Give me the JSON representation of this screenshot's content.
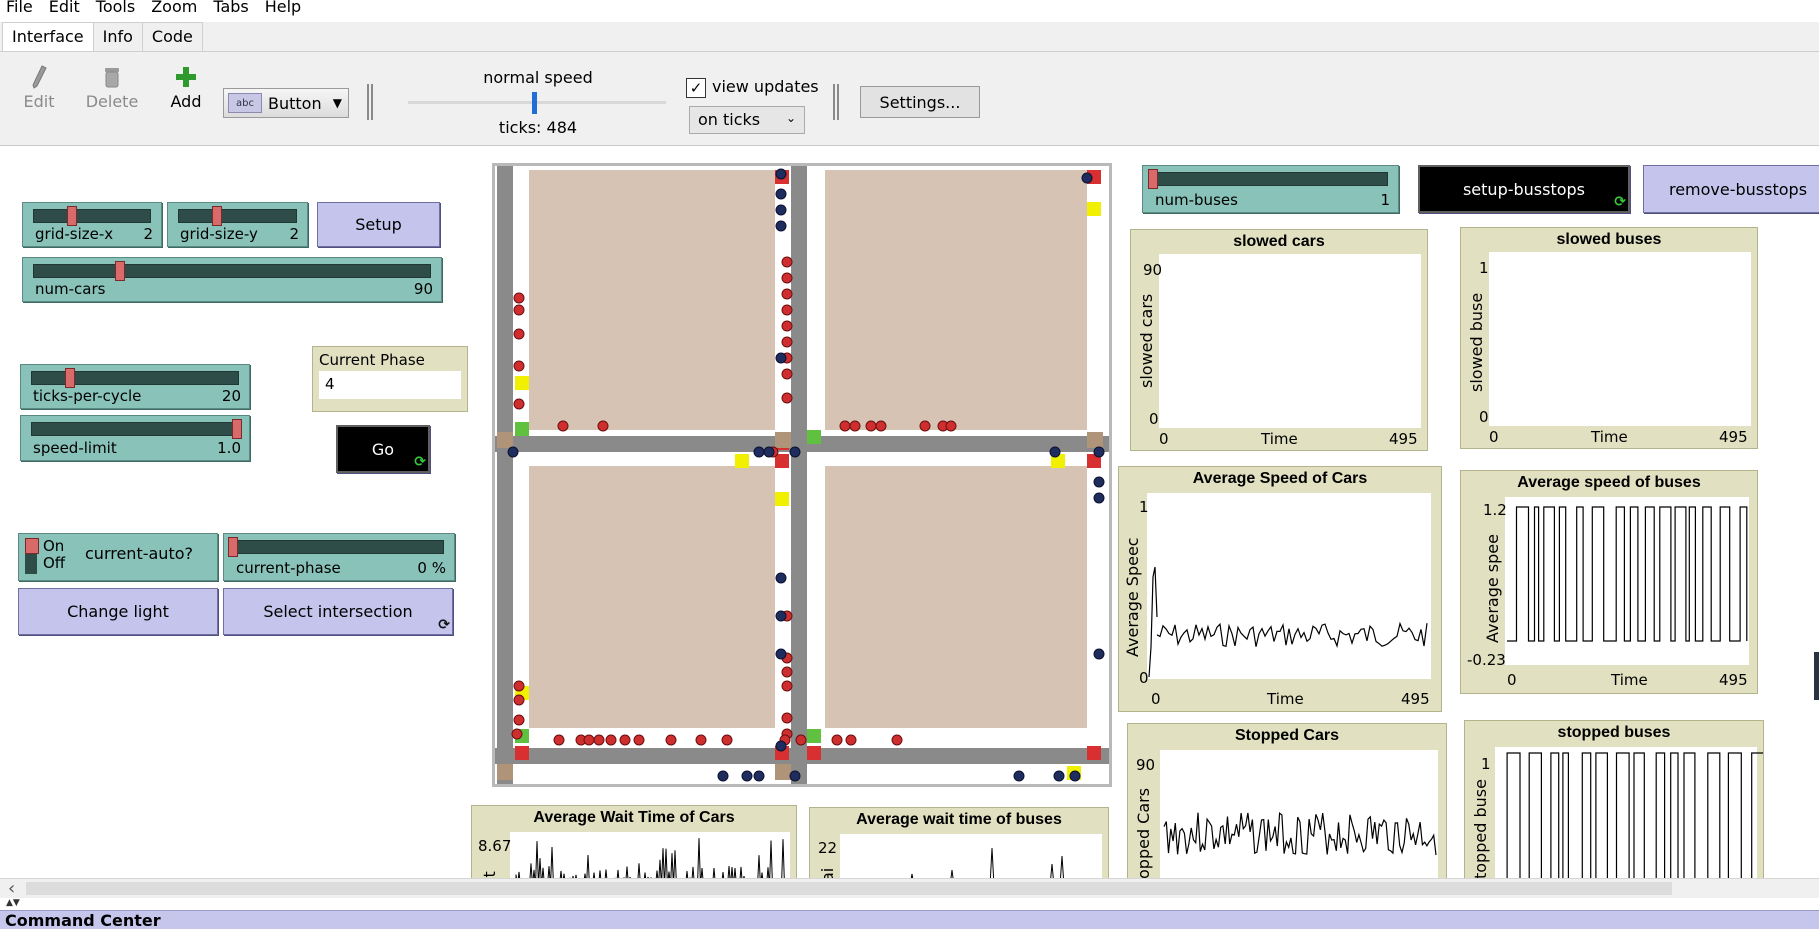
{
  "menu": [
    "File",
    "Edit",
    "Tools",
    "Zoom",
    "Tabs",
    "Help"
  ],
  "tabs": [
    "Interface",
    "Info",
    "Code"
  ],
  "toolbar": {
    "edit": "Edit",
    "delete": "Delete",
    "add": "Add",
    "widget_type": "Button",
    "speed_label": "normal speed",
    "ticks_label": "ticks: 484",
    "view_updates_label": "view updates",
    "view_updates_checked": true,
    "update_mode": "on ticks",
    "settings": "Settings..."
  },
  "widgets": {
    "grid_size_x": {
      "name": "grid-size-x",
      "value": "2",
      "fraction": 0.3
    },
    "grid_size_y": {
      "name": "grid-size-y",
      "value": "2",
      "fraction": 0.3
    },
    "setup": "Setup",
    "num_cars": {
      "name": "num-cars",
      "value": "90",
      "fraction": 0.22
    },
    "ticks_per_cycle": {
      "name": "ticks-per-cycle",
      "value": "20",
      "fraction": 0.18
    },
    "speed_limit": {
      "name": "speed-limit",
      "value": "1.0",
      "fraction": 1.0
    },
    "current_phase_monitor": {
      "label": "Current Phase",
      "value": "4"
    },
    "go": "Go",
    "current_auto": {
      "on": "On",
      "off": "Off",
      "name": "current-auto?"
    },
    "current_phase_slider": {
      "name": "current-phase",
      "value": "0 %",
      "fraction": 0.0
    },
    "change_light": "Change light",
    "select_intersection": "Select intersection",
    "num_buses": {
      "name": "num-buses",
      "value": "1",
      "fraction": 0.0
    },
    "setup_busstops": "setup-busstops",
    "remove_busstops": "remove-busstops"
  },
  "plots": {
    "slowed_cars": {
      "title": "slowed cars",
      "ylabel": "slowed cars",
      "xlabel": "Time",
      "ymax": "90",
      "ymin": "0",
      "xmin": "0",
      "xmax": "495"
    },
    "slowed_buses": {
      "title": "slowed buses",
      "ylabel": "slowed buse",
      "xlabel": "Time",
      "ymax": "1",
      "ymin": "0",
      "xmin": "0",
      "xmax": "495"
    },
    "avg_speed_cars": {
      "title": "Average Speed of Cars",
      "ylabel": "Average Speec",
      "xlabel": "Time",
      "ymax": "1",
      "ymin": "0",
      "xmin": "0",
      "xmax": "495"
    },
    "avg_speed_buses": {
      "title": "Average speed of buses",
      "ylabel": "Average spee",
      "xlabel": "Time",
      "ymax": "1.2",
      "ymin": "-0.23",
      "xmin": "0",
      "xmax": "495"
    },
    "stopped_cars": {
      "title": "Stopped Cars",
      "ylabel": "opped Cars",
      "ymax": "90"
    },
    "stopped_buses": {
      "title": "stopped buses",
      "ylabel": "topped buse",
      "ymax": "1"
    },
    "avg_wait_cars": {
      "title": "Average Wait Time of Cars",
      "ylabel": "it",
      "ymax": "8.67"
    },
    "avg_wait_buses": {
      "title": "Average wait time of buses",
      "ylabel": "ai",
      "ymax": "22"
    }
  },
  "command_center": "Command Center"
}
